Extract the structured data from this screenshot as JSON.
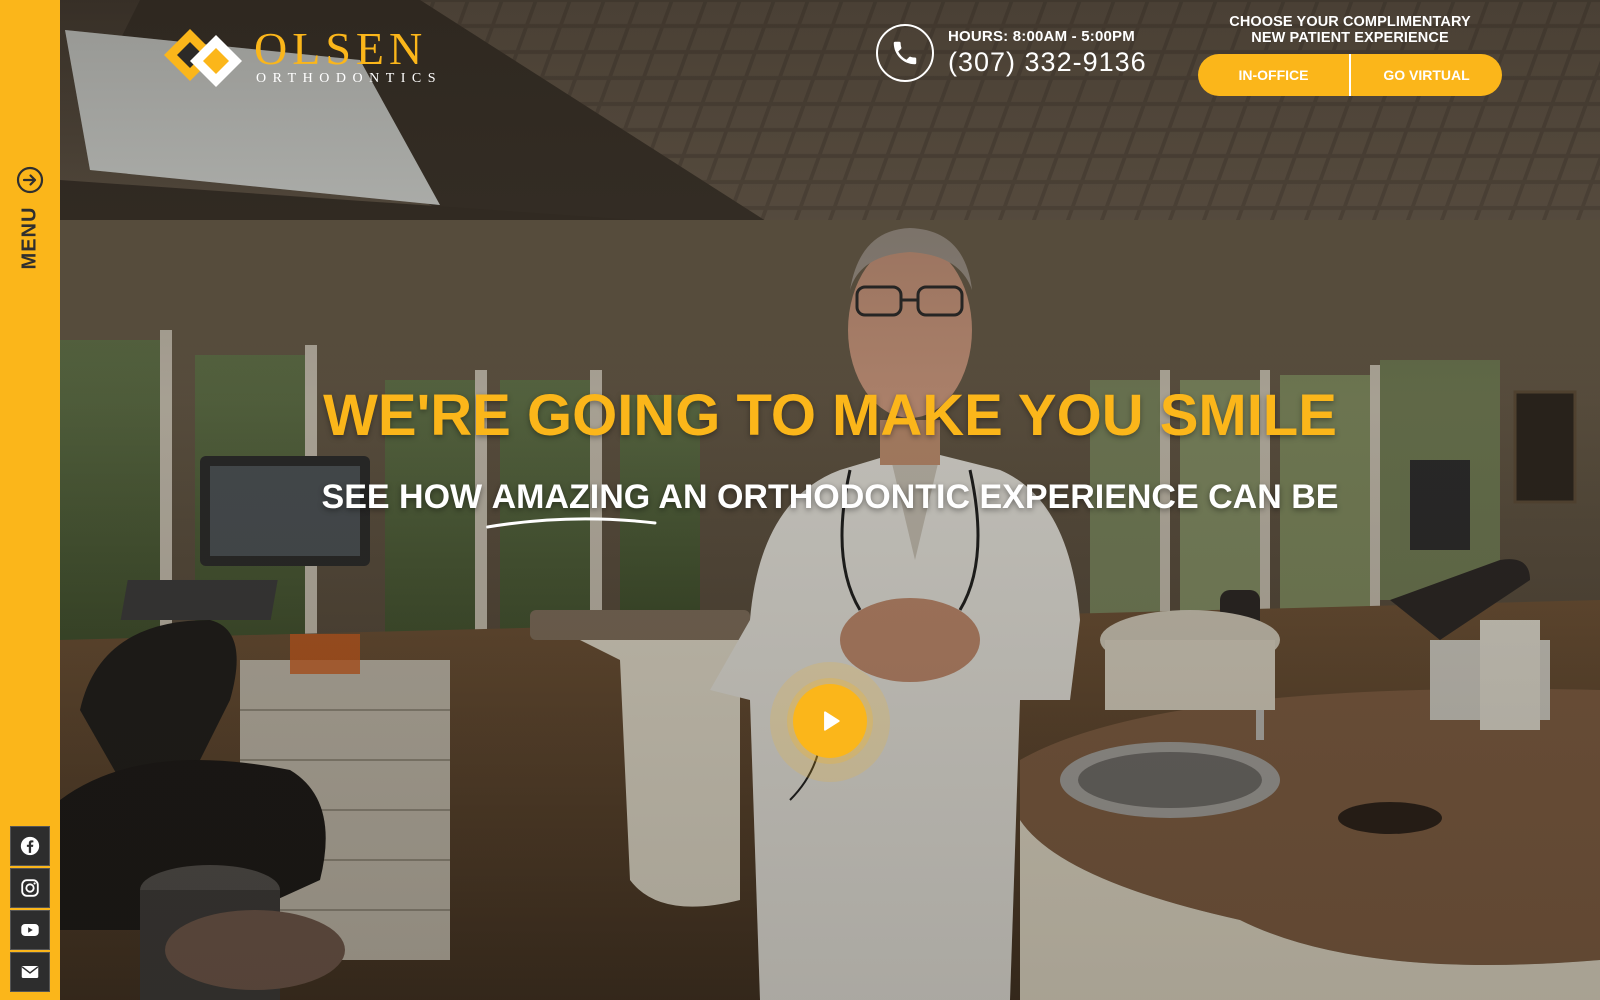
{
  "brand": {
    "name": "OLSEN",
    "tagline": "ORTHODONTICS"
  },
  "header": {
    "hours": "HOURS: 8:00AM - 5:00PM",
    "phone": "(307) 332-9136",
    "cta_title_line1": "CHOOSE YOUR COMPLIMENTARY",
    "cta_title_line2": "NEW PATIENT EXPERIENCE",
    "btn_in_office": "IN-OFFICE",
    "btn_virtual": "GO VIRTUAL"
  },
  "sidebar": {
    "menu_label": "MENU",
    "social": [
      {
        "icon": "facebook-icon"
      },
      {
        "icon": "instagram-icon"
      },
      {
        "icon": "youtube-icon"
      },
      {
        "icon": "email-icon"
      }
    ]
  },
  "hero": {
    "headline": "WE'RE GOING TO MAKE YOU SMILE",
    "sub_before": "SEE HOW ",
    "sub_emphasis": "AMAZING",
    "sub_after": " AN ORTHODONTIC EXPERIENCE CAN BE"
  },
  "colors": {
    "accent": "#fbb61a",
    "sidebar_social_bg": "#2d2d2d",
    "text_light": "#ffffff"
  }
}
